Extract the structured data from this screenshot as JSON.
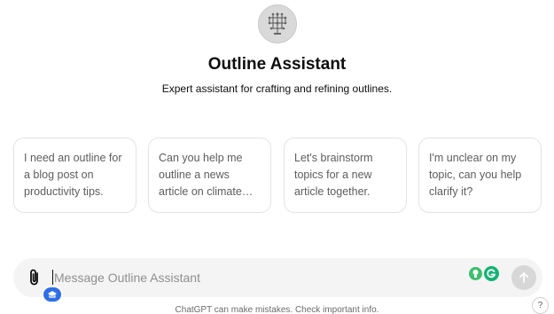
{
  "assistant": {
    "name": "Outline Assistant",
    "description": "Expert assistant for crafting and refining outlines.",
    "avatar_icon": "tree-diagram-icon"
  },
  "suggestions": [
    {
      "text": "I need an outline for a blog post on productivity tips."
    },
    {
      "text": "Can you help me outline a news article on climate change?"
    },
    {
      "text": "Let's brainstorm topics for a new article together."
    },
    {
      "text": "I'm unclear on my topic, can you help clarify it?"
    }
  ],
  "composer": {
    "placeholder": "Message Outline Assistant",
    "value": "",
    "attach_icon": "paperclip-icon",
    "send_icon": "arrow-up-icon"
  },
  "extensions": {
    "hint_icon": "lightbulb-icon",
    "grammar_icon": "grammarly-icon",
    "badge_icon": "cap-icon"
  },
  "footer": {
    "text": "ChatGPT can make mistakes. Check important info."
  },
  "help": {
    "label": "?"
  },
  "colors": {
    "composer_bg": "#f4f4f4",
    "card_border": "#e3e3e3",
    "send_disabled": "#d7d7d7",
    "grammarly": "#15b374",
    "badge": "#2f6fe6"
  }
}
